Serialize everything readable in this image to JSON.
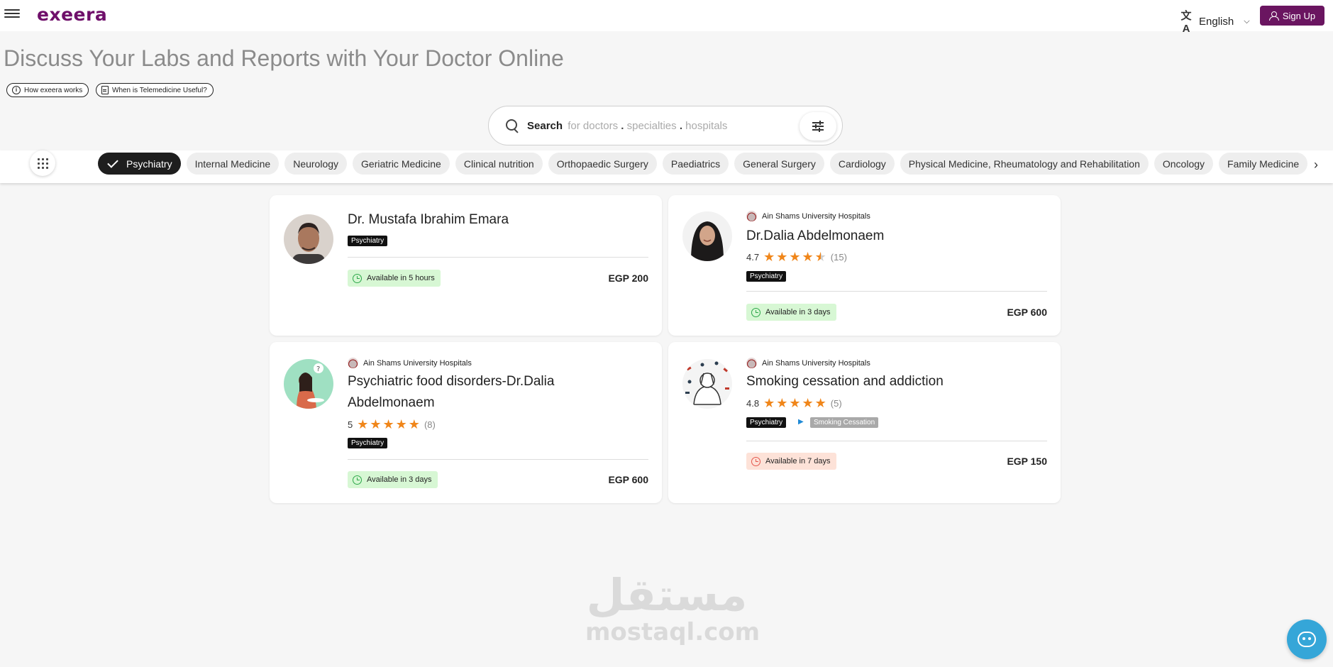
{
  "brand": {
    "logo_text": "exeera",
    "accent_color": "#6a1560"
  },
  "topbar": {
    "language": "English",
    "signup_label": "Sign Up"
  },
  "header": {
    "title": "Discuss Your Labs and Reports with Your Doctor Online",
    "links": [
      "How exeera works",
      "When is Telemedicine Useful?"
    ]
  },
  "search": {
    "label": "Search",
    "hint_1": "for doctors",
    "hint_2": "specialties",
    "hint_3": "hospitals",
    "separator": "."
  },
  "categories": {
    "selected": "Psychiatry",
    "items": [
      "Psychiatry",
      "Internal Medicine",
      "Neurology",
      "Geriatric Medicine",
      "Clinical nutrition",
      "Orthopaedic Surgery",
      "Paediatrics",
      "General Surgery",
      "Cardiology",
      "Physical Medicine, Rheumatology and Rehabilitation",
      "Oncology",
      "Family Medicine"
    ]
  },
  "doctors": [
    {
      "name": "Dr. Mustafa Ibrahim Emara",
      "specialty": "Psychiatry",
      "availability": "Available in 5 hours",
      "price": "EGP 200"
    },
    {
      "hospital": "Ain Shams University Hospitals",
      "name": "Dr.Dalia Abdelmonaem",
      "rating": "4.7",
      "rating_value": 4.7,
      "reviews": "(15)",
      "specialty": "Psychiatry",
      "availability": "Available in 3 days",
      "price": "EGP 600"
    },
    {
      "hospital": "Ain Shams University Hospitals",
      "name_line1": "Psychiatric food disorders-Dr.Dalia",
      "name_line2": "Abdelmonaem",
      "rating": "5",
      "rating_value": 5,
      "reviews": "(8)",
      "specialty": "Psychiatry",
      "availability": "Available in 3 days",
      "price": "EGP 600"
    },
    {
      "hospital": "Ain Shams University Hospitals",
      "name": "Smoking cessation and addiction",
      "rating": "4.8",
      "rating_value": 4.8,
      "reviews": "(5)",
      "specialty": "Psychiatry",
      "subspecialty": "Smoking Cessation",
      "availability": "Available in 7 days",
      "price": "EGP 150"
    }
  ],
  "watermark": {
    "arabic": "مستقل",
    "latin": "mostaql.com"
  }
}
